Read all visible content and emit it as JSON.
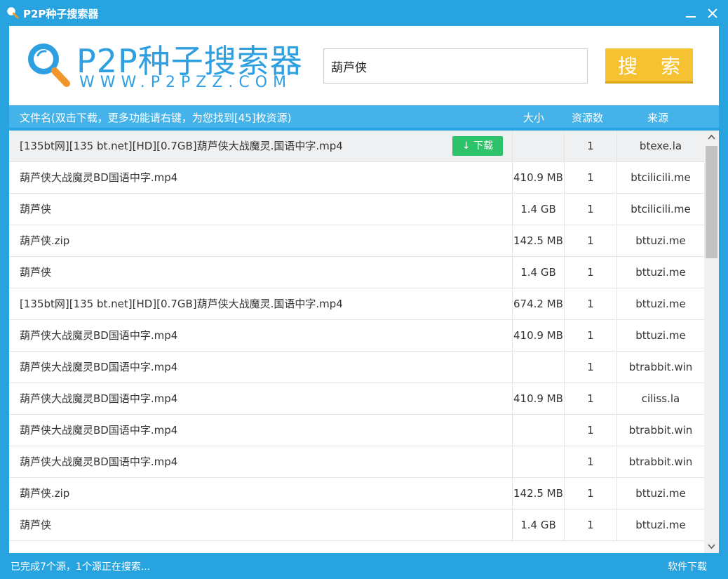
{
  "window": {
    "title": "P2P种子搜索器"
  },
  "logo": {
    "title": "P2P种子搜索器",
    "url": "WWW.P2PZZ.COM"
  },
  "search": {
    "value": "葫芦侠",
    "button_label": "搜 索"
  },
  "columns": {
    "name": "文件名(双击下载，更多功能请右键，为您找到[45]枚资源)",
    "size": "大小",
    "sources": "资源数",
    "origin": "来源"
  },
  "download_button": "↓ 下载",
  "rows": [
    {
      "name": "[135bt网][135 bt.net][HD][0.7GB]葫芦侠大战魔灵.国语中字.mp4",
      "size": "",
      "sources": "1",
      "origin": "btexe.la"
    },
    {
      "name": "葫芦侠大战魔灵BD国语中字.mp4",
      "size": "410.9 MB",
      "sources": "1",
      "origin": "btcilicili.me"
    },
    {
      "name": "葫芦侠",
      "size": "1.4 GB",
      "sources": "1",
      "origin": "btcilicili.me"
    },
    {
      "name": "葫芦侠.zip",
      "size": "142.5 MB",
      "sources": "1",
      "origin": "bttuzi.me"
    },
    {
      "name": "葫芦侠",
      "size": "1.4 GB",
      "sources": "1",
      "origin": "bttuzi.me"
    },
    {
      "name": "[135bt网][135 bt.net][HD][0.7GB]葫芦侠大战魔灵.国语中字.mp4",
      "size": "674.2 MB",
      "sources": "1",
      "origin": "bttuzi.me"
    },
    {
      "name": "葫芦侠大战魔灵BD国语中字.mp4",
      "size": "410.9 MB",
      "sources": "1",
      "origin": "bttuzi.me"
    },
    {
      "name": "葫芦侠大战魔灵BD国语中字.mp4",
      "size": "",
      "sources": "1",
      "origin": "btrabbit.win"
    },
    {
      "name": "葫芦侠大战魔灵BD国语中字.mp4",
      "size": "410.9 MB",
      "sources": "1",
      "origin": "ciliss.la"
    },
    {
      "name": "葫芦侠大战魔灵BD国语中字.mp4",
      "size": "",
      "sources": "1",
      "origin": "btrabbit.win"
    },
    {
      "name": "葫芦侠大战魔灵BD国语中字.mp4",
      "size": "",
      "sources": "1",
      "origin": "btrabbit.win"
    },
    {
      "name": "葫芦侠.zip",
      "size": "142.5 MB",
      "sources": "1",
      "origin": "bttuzi.me"
    },
    {
      "name": "葫芦侠",
      "size": "1.4 GB",
      "sources": "1",
      "origin": "bttuzi.me"
    }
  ],
  "status": {
    "text": "已完成7个源，1个源正在搜索...",
    "software_link": "软件下载"
  },
  "colors": {
    "primary_blue": "#27a3e0",
    "header_blue": "#45b2ea",
    "search_yellow": "#f6c232",
    "download_green": "#2dc36a",
    "logo_orange": "#f0962a"
  },
  "icons": {
    "app": "magnifier-icon",
    "minimize": "minimize-icon",
    "close": "close-icon",
    "download": "download-arrow-icon",
    "scroll_up": "chevron-up-icon",
    "scroll_down": "chevron-down-icon"
  }
}
